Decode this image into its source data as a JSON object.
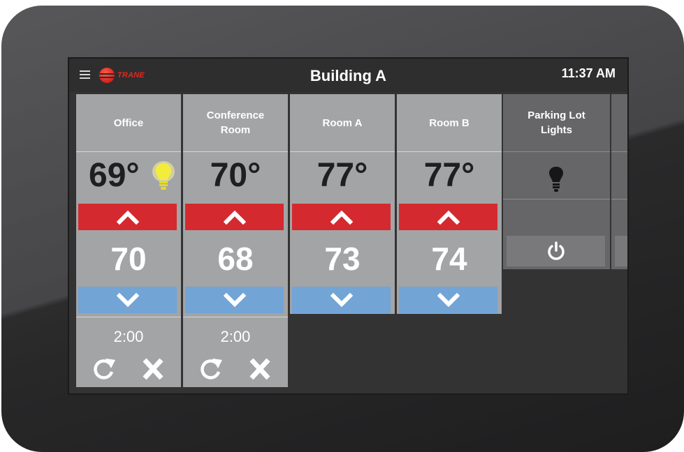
{
  "header": {
    "brand": "TRANE",
    "title": "Building A",
    "time": "11:37 AM"
  },
  "zones": [
    {
      "name_line1": "Office",
      "name_line2": "",
      "temperature": "69°",
      "setpoint": "70",
      "light_on": true,
      "timer": "2:00",
      "has_schedule": true
    },
    {
      "name_line1": "Conference",
      "name_line2": "Room",
      "temperature": "70°",
      "setpoint": "68",
      "light_on": false,
      "timer": "2:00",
      "has_schedule": true
    },
    {
      "name_line1": "Room A",
      "name_line2": "",
      "temperature": "77°",
      "setpoint": "73",
      "light_on": false,
      "has_schedule": false
    },
    {
      "name_line1": "Room B",
      "name_line2": "",
      "temperature": "77°",
      "setpoint": "74",
      "light_on": false,
      "has_schedule": false
    }
  ],
  "lights": {
    "name_line1": "Parking Lot",
    "name_line2": "Lights",
    "state": "off"
  },
  "icons": {
    "menu": "hamburger-menu-icon",
    "up": "chevron-up-icon",
    "down": "chevron-down-icon",
    "bulb": "light-bulb-icon",
    "refresh": "refresh-icon",
    "close": "close-icon",
    "power": "power-icon"
  },
  "colors": {
    "up_button": "#d42a2f",
    "down_button": "#72a4d6",
    "tile": "#a3a4a6",
    "light_tile": "#666668",
    "bulb_on": "#f4ec3a",
    "brand": "#e3281f"
  }
}
